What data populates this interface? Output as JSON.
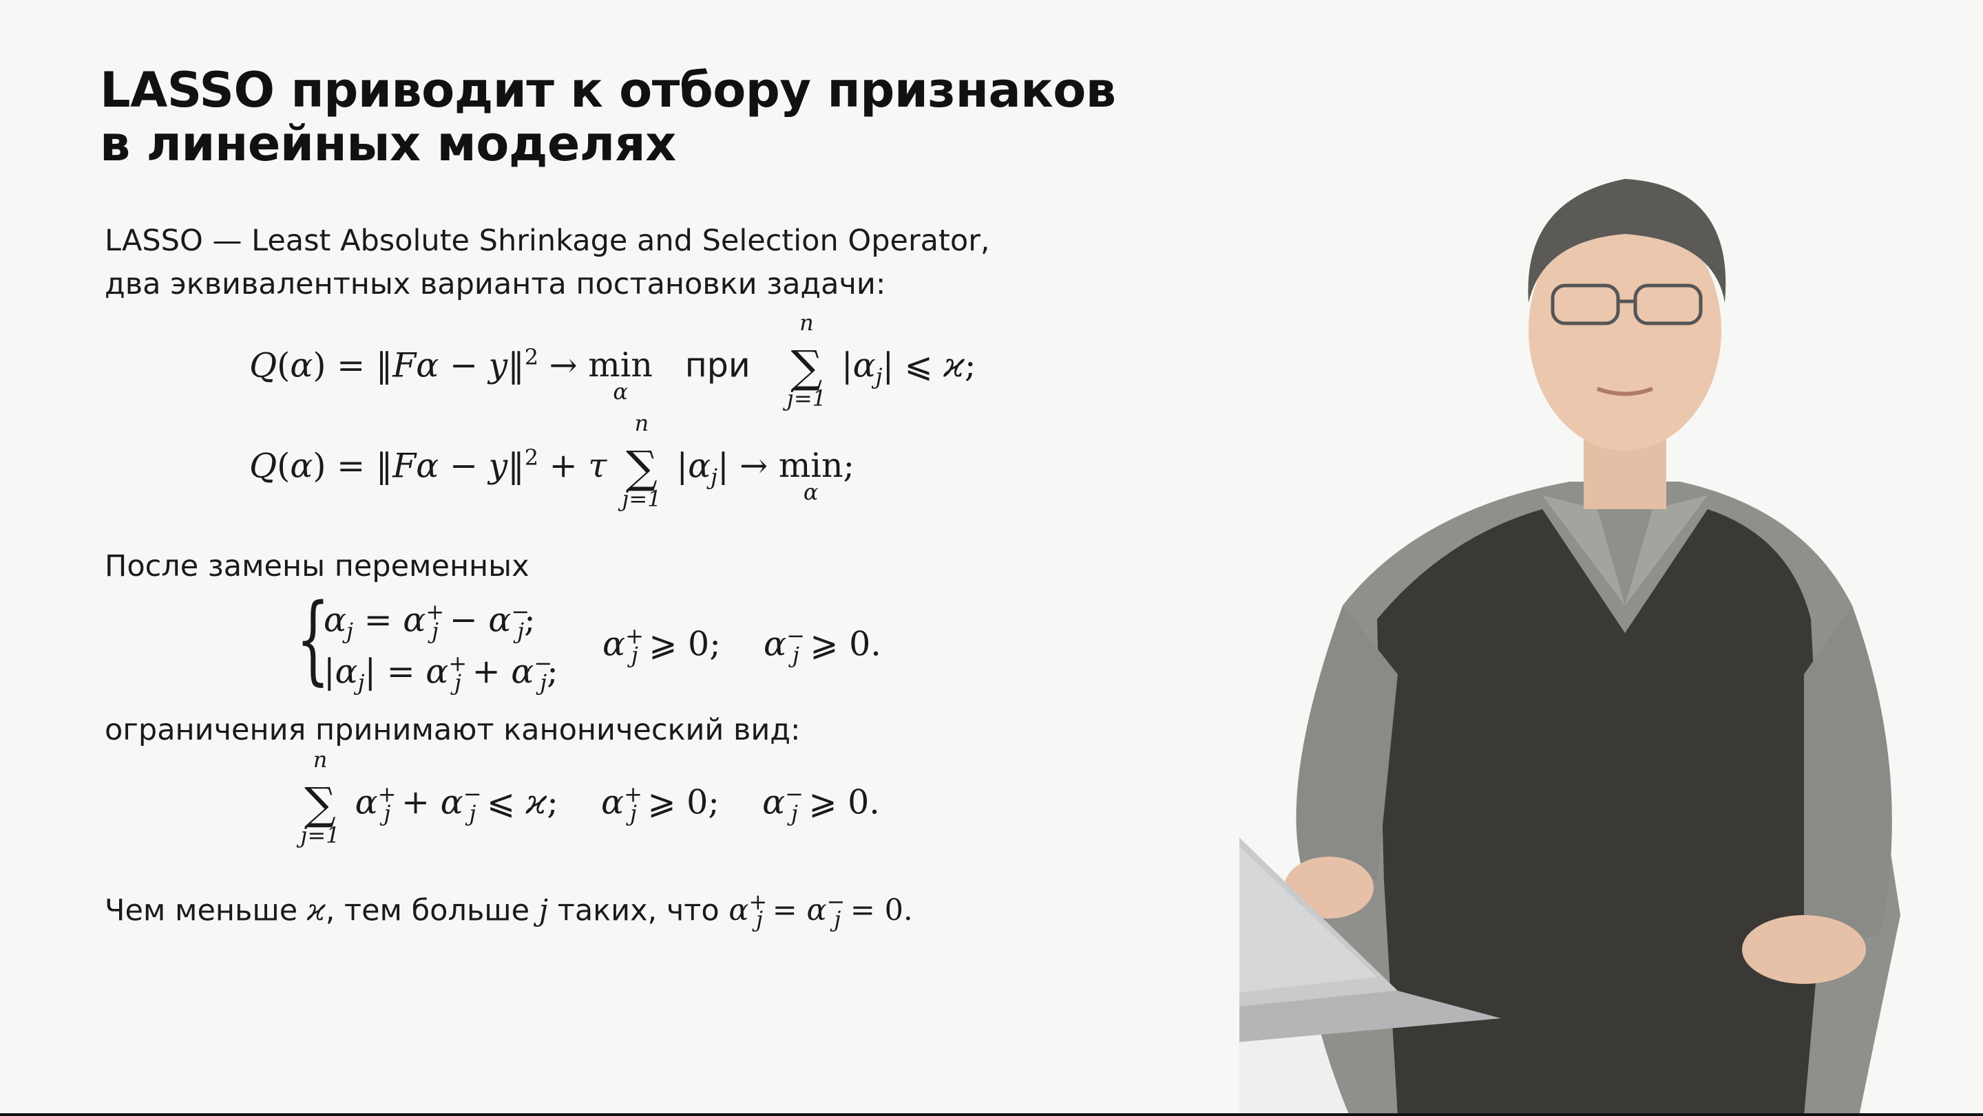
{
  "slide": {
    "title_line1": "LASSO приводит к отбору признаков",
    "title_line2": "в линейных моделях",
    "intro_line1": "LASSO — Least Absolute Shrinkage and Selection Operator,",
    "intro_line2": "два эквивалентных варианта постановки задачи:",
    "after_change": "После замены переменных",
    "constraints_canonical": "ограничения принимают канонический вид:",
    "conclusion_prefix": "Чем меньше",
    "conclusion_mid": ", тем больше",
    "conclusion_suffix": " таких, что",
    "word_pri": "при",
    "word_min": "min"
  },
  "scene": {
    "background": "#f7f7f6",
    "vest_color": "#3a3936",
    "shirt_color": "#8f8f8c",
    "laptop_color": "#c9cacc",
    "podium_gold": "#d9b93a",
    "podium_white": "#eeeeee"
  }
}
